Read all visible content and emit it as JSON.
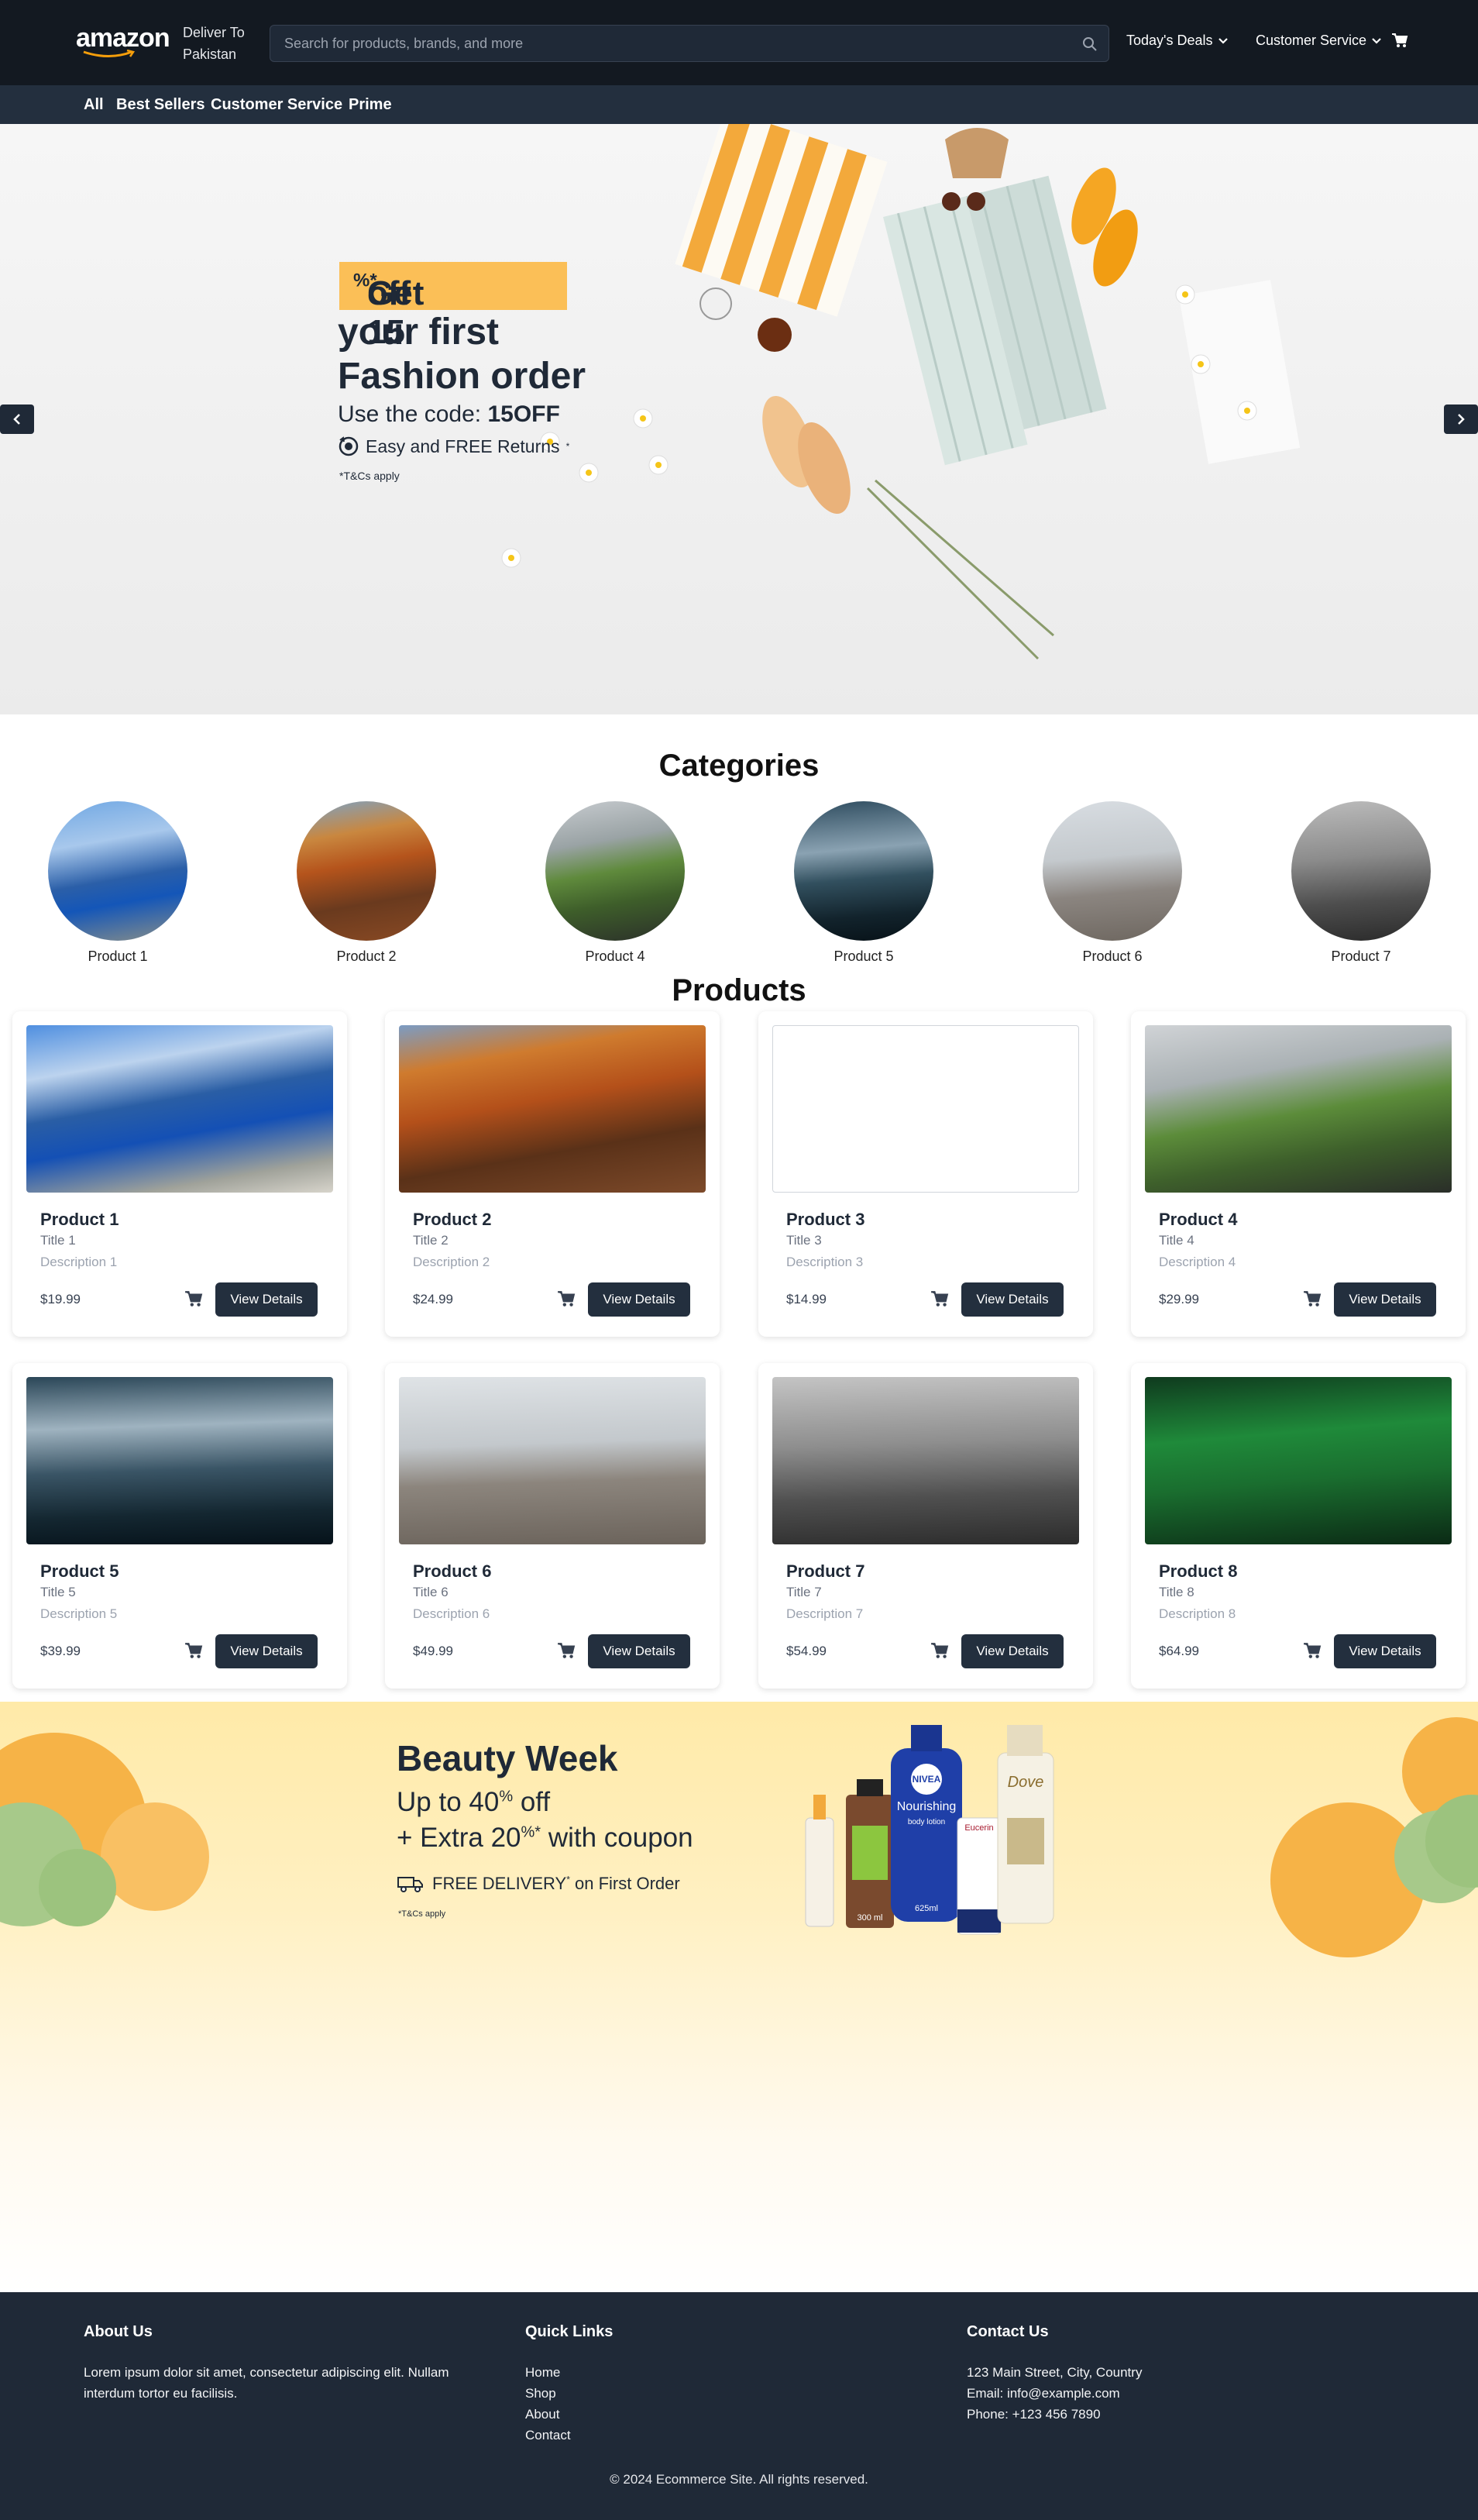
{
  "header": {
    "logo": "amazon",
    "deliver_line1": "Deliver To",
    "deliver_line2": "Pakistan",
    "search_placeholder": "Search for products, brands, and more",
    "deals_label": "Today's Deals",
    "service_label": "Customer Service"
  },
  "subnav": {
    "items": [
      "All",
      "Best Sellers",
      "Customer Service",
      "Prime"
    ]
  },
  "hero": {
    "badge": "Get 15",
    "badge_pct": "%",
    "badge_rest": " off",
    "badge_star": "*",
    "line2": "your first",
    "line3": "Fashion order",
    "code_prefix": "Use the code: ",
    "code": "15OFF",
    "returns": "Easy and FREE Returns",
    "returns_mark": "*",
    "tc": "*T&Cs apply"
  },
  "categories": {
    "title": "Categories",
    "items": [
      "Product 1",
      "Product 2",
      "Product 4",
      "Product 5",
      "Product 6",
      "Product 7"
    ]
  },
  "products": {
    "title": "Products",
    "button_label": "View Details",
    "items": [
      {
        "name": "Product 1",
        "title": "Title 1",
        "description": "Description 1",
        "price": "$19.99"
      },
      {
        "name": "Product 2",
        "title": "Title 2",
        "description": "Description 2",
        "price": "$24.99"
      },
      {
        "name": "Product 3",
        "title": "Title 3",
        "description": "Description 3",
        "price": "$14.99"
      },
      {
        "name": "Product 4",
        "title": "Title 4",
        "description": "Description 4",
        "price": "$29.99"
      },
      {
        "name": "Product 5",
        "title": "Title 5",
        "description": "Description 5",
        "price": "$39.99"
      },
      {
        "name": "Product 6",
        "title": "Title 6",
        "description": "Description 6",
        "price": "$49.99"
      },
      {
        "name": "Product 7",
        "title": "Title 7",
        "description": "Description 7",
        "price": "$54.99"
      },
      {
        "name": "Product 8",
        "title": "Title 8",
        "description": "Description 8",
        "price": "$64.99"
      }
    ]
  },
  "beauty": {
    "title": "Beauty Week",
    "line2_a": "Up to 40",
    "line2_pct": "%",
    "line2_b": " off",
    "line3_a": "+ Extra 20",
    "line3_sup": "%*",
    "line3_b": " with coupon",
    "delivery": "FREE DELIVERY",
    "delivery_mark": "*",
    "delivery_rest": " on First Order",
    "tc": "*T&Cs apply",
    "product_labels": [
      "NIVEA",
      "Nourishing",
      "body lotion",
      "625ml",
      "Eucerin",
      "Dove",
      "300 ml"
    ]
  },
  "footer": {
    "about_title": "About Us",
    "about_text": "Lorem ipsum dolor sit amet, consectetur adipiscing elit. Nullam interdum tortor eu facilisis.",
    "links_title": "Quick Links",
    "links": [
      "Home",
      "Shop",
      "About",
      "Contact"
    ],
    "contact_title": "Contact Us",
    "address": "123 Main Street, City, Country",
    "email": "Email: info@example.com",
    "phone": "Phone: +123 456 7890",
    "copyright": "© 2024 Ecommerce Site. All rights reserved."
  },
  "colors": {
    "nav_bg": "#131921",
    "subnav_bg": "#232f3e",
    "accent": "#fbbf57",
    "footer_bg": "#1f2937"
  },
  "icons": [
    "search-icon",
    "chevron-down-icon",
    "cart-icon",
    "chevron-left-icon",
    "chevron-right-icon",
    "returns-icon",
    "truck-icon"
  ]
}
